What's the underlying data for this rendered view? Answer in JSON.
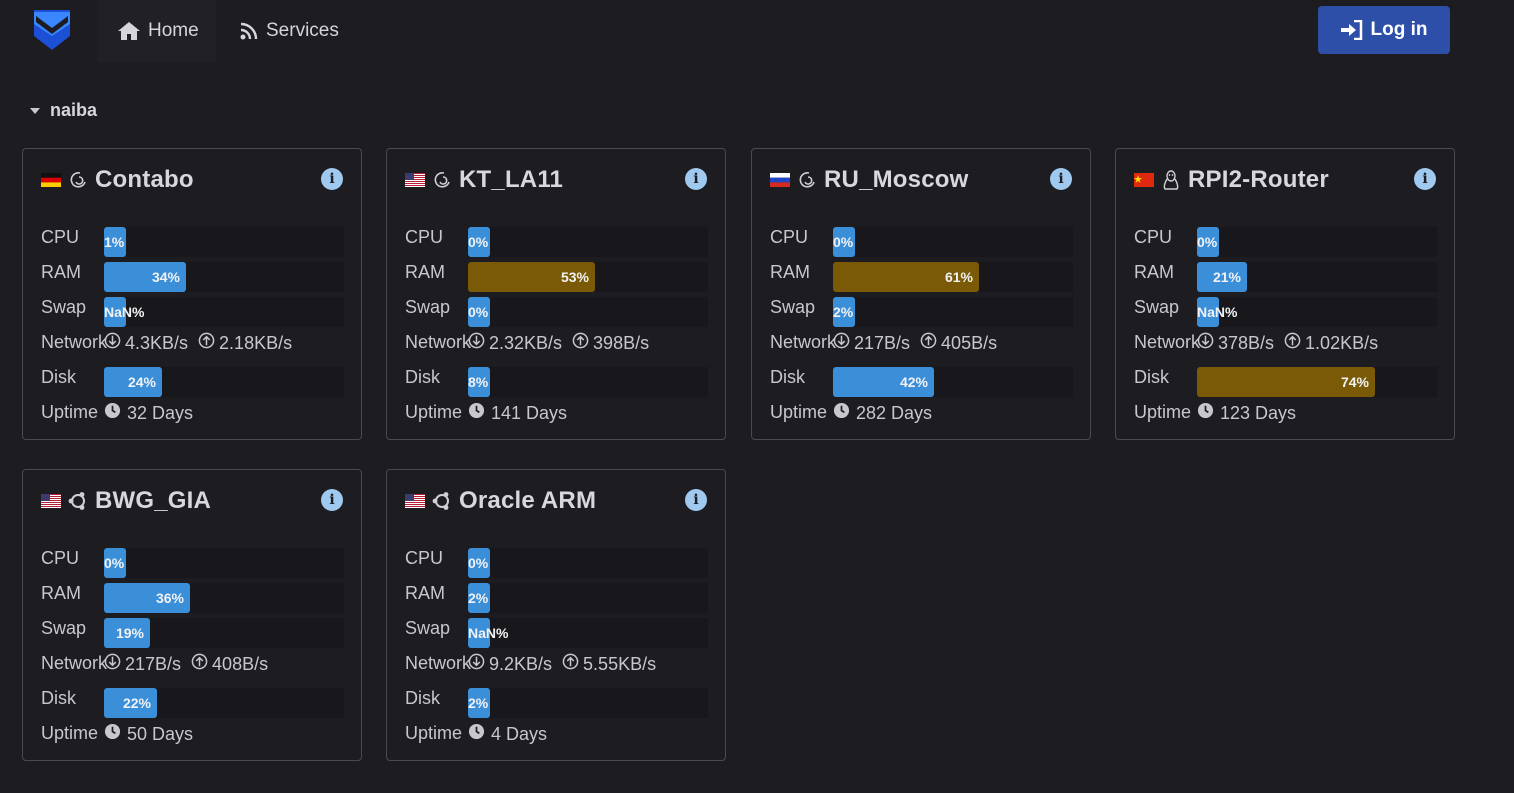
{
  "nav": {
    "home_label": "Home",
    "services_label": "Services",
    "login_label": "Log in"
  },
  "group": {
    "name": "naiba"
  },
  "labels": {
    "cpu": "CPU",
    "ram": "RAM",
    "swap": "Swap",
    "network": "Network",
    "disk": "Disk",
    "uptime": "Uptime"
  },
  "colors": {
    "bar_normal": "#3b8fd9",
    "bar_warning": "#7a5a06",
    "login_button": "#2d4fa8",
    "info_icon": "#9fc9ef"
  },
  "servers": [
    {
      "name": "Contabo",
      "flag": "de",
      "os_icon": "debian-icon",
      "cpu": {
        "text": "1%",
        "fraction": 0.01
      },
      "ram": {
        "text": "34%",
        "fraction": 0.34
      },
      "swap": {
        "text": "NaN%",
        "fraction": 0.0
      },
      "net_down": "4.3KB/s",
      "net_up": "2.18KB/s",
      "disk": {
        "text": "24%",
        "fraction": 0.24
      },
      "uptime": "32 Days"
    },
    {
      "name": "KT_LA11",
      "flag": "us",
      "os_icon": "debian-icon",
      "cpu": {
        "text": "0%",
        "fraction": 0.0
      },
      "ram": {
        "text": "53%",
        "fraction": 0.53
      },
      "swap": {
        "text": "0%",
        "fraction": 0.0
      },
      "net_down": "2.32KB/s",
      "net_up": "398B/s",
      "disk": {
        "text": "8%",
        "fraction": 0.08
      },
      "uptime": "141 Days"
    },
    {
      "name": "RU_Moscow",
      "flag": "ru",
      "os_icon": "debian-icon",
      "cpu": {
        "text": "0%",
        "fraction": 0.0
      },
      "ram": {
        "text": "61%",
        "fraction": 0.61
      },
      "swap": {
        "text": "2%",
        "fraction": 0.02
      },
      "net_down": "217B/s",
      "net_up": "405B/s",
      "disk": {
        "text": "42%",
        "fraction": 0.42
      },
      "uptime": "282 Days"
    },
    {
      "name": "RPI2-Router",
      "flag": "cn",
      "os_icon": "linux-icon",
      "cpu": {
        "text": "0%",
        "fraction": 0.0
      },
      "ram": {
        "text": "21%",
        "fraction": 0.21
      },
      "swap": {
        "text": "NaN%",
        "fraction": 0.0
      },
      "net_down": "378B/s",
      "net_up": "1.02KB/s",
      "disk": {
        "text": "74%",
        "fraction": 0.74
      },
      "uptime": "123 Days"
    },
    {
      "name": "BWG_GIA",
      "flag": "us",
      "os_icon": "ubuntu-icon",
      "cpu": {
        "text": "0%",
        "fraction": 0.0
      },
      "ram": {
        "text": "36%",
        "fraction": 0.36
      },
      "swap": {
        "text": "19%",
        "fraction": 0.19
      },
      "net_down": "217B/s",
      "net_up": "408B/s",
      "disk": {
        "text": "22%",
        "fraction": 0.22
      },
      "uptime": "50 Days"
    },
    {
      "name": "Oracle ARM",
      "flag": "us",
      "os_icon": "ubuntu-icon",
      "cpu": {
        "text": "0%",
        "fraction": 0.0
      },
      "ram": {
        "text": "2%",
        "fraction": 0.02
      },
      "swap": {
        "text": "NaN%",
        "fraction": 0.0
      },
      "net_down": "9.2KB/s",
      "net_up": "5.55KB/s",
      "disk": {
        "text": "2%",
        "fraction": 0.02
      },
      "uptime": "4 Days"
    }
  ]
}
